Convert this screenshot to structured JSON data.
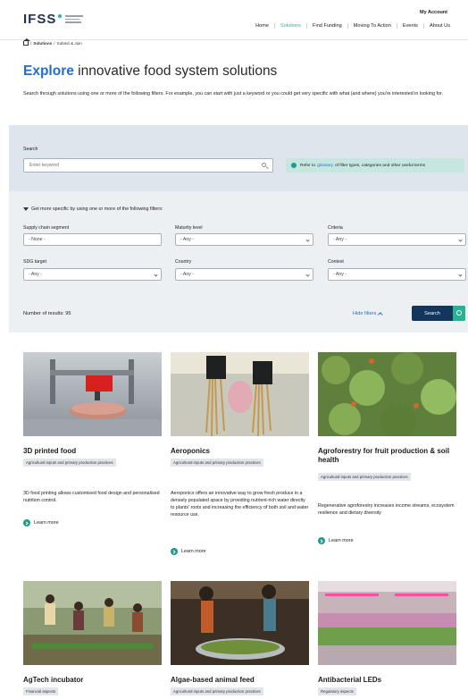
{
  "header": {
    "logo_text": "IFSS",
    "my_account": "My Account",
    "nav": [
      "Home",
      "Solutions",
      "Find Funding",
      "Moving To Action",
      "Events",
      "About Us"
    ],
    "active_nav": "Solutions"
  },
  "breadcrumb": {
    "solutions": "Solutions",
    "separator": "/",
    "current": "Submit & Join"
  },
  "title": {
    "accent": "Explore",
    "rest": " innovative food system solutions"
  },
  "intro": "Search through solutions using one or more of the following filters. For example, you can start with just a keyword or you could get very specific with what (and where) you're interested in looking for.",
  "search": {
    "label": "Search",
    "placeholder": "Enter keyword",
    "note_before": "Refer to",
    "note_link": "glossary",
    "note_after": "of filter types, categories and other useful terms"
  },
  "filters": {
    "heading": "Get more specific by using one or more of the following filters:",
    "supply_chain": {
      "label": "Supply chain segment",
      "value": "- None -"
    },
    "maturity": {
      "label": "Maturity level",
      "value": "- Any -"
    },
    "criteria": {
      "label": "Criteria",
      "value": "- Any -"
    },
    "sdg": {
      "label": "SDG target",
      "value": "- Any -"
    },
    "country": {
      "label": "Country",
      "value": "- Any -"
    },
    "context": {
      "label": "Context",
      "value": "- Any -"
    }
  },
  "results": {
    "count_label": "Number of results: 95",
    "hide_filters": "Hide filters",
    "search_button": "Search"
  },
  "cards": [
    {
      "title": "3D printed food",
      "tag": "Agricultural inputs and primary production practices",
      "description": "3D food printing allows customised food design and personalised nutrition control.",
      "link": "Learn more"
    },
    {
      "title": "Aeroponics",
      "tag": "Agricultural inputs and primary production practices",
      "description": "Aeroponics offers an innovative way to grow fresh produce in a densely populated space by providing nutrient-rich water directly to plants' roots and increasing the efficiency of both soil and water resource use.",
      "link": "Learn more"
    },
    {
      "title": "Agroforestry for fruit production & soil health",
      "tag": "Agricultural inputs and primary production practices",
      "description": "Regenerative agroforestry increases income streams, ecosystem resilience and dietary diversity",
      "link": "Learn more"
    },
    {
      "title": "AgTech incubator",
      "tag": "Financial aspects"
    },
    {
      "title": "Algae-based animal feed",
      "tag": "Agricultural inputs and primary production practices"
    },
    {
      "title": "Antibacterial LEDs",
      "tag": "Regulatory aspects"
    }
  ],
  "colors": {
    "accent_blue": "#1f6ed4",
    "teal": "#25b394",
    "navy": "#14365c",
    "panel": "#edf0f3"
  }
}
